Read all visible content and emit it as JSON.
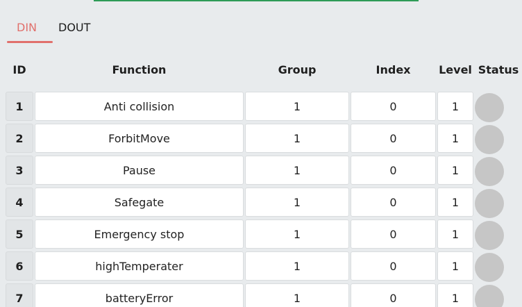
{
  "tabs": {
    "din_label": "DIN",
    "dout_label": "DOUT",
    "active": "DIN"
  },
  "table": {
    "headers": {
      "id": "ID",
      "function": "Function",
      "group": "Group",
      "index": "Index",
      "level": "Level",
      "status": "Status"
    },
    "rows": [
      {
        "id": "1",
        "function": "Anti collision",
        "group": "1",
        "index": "0",
        "level": "1",
        "status": "off"
      },
      {
        "id": "2",
        "function": "ForbitMove",
        "group": "1",
        "index": "0",
        "level": "1",
        "status": "off"
      },
      {
        "id": "3",
        "function": "Pause",
        "group": "1",
        "index": "0",
        "level": "1",
        "status": "off"
      },
      {
        "id": "4",
        "function": "Safegate",
        "group": "1",
        "index": "0",
        "level": "1",
        "status": "off"
      },
      {
        "id": "5",
        "function": "Emergency stop",
        "group": "1",
        "index": "0",
        "level": "1",
        "status": "off"
      },
      {
        "id": "6",
        "function": "highTemperater",
        "group": "1",
        "index": "0",
        "level": "1",
        "status": "off"
      },
      {
        "id": "7",
        "function": "batteryError",
        "group": "1",
        "index": "0",
        "level": "1",
        "status": "off"
      }
    ]
  },
  "colors": {
    "active_tab": "#e1706c",
    "accent_strip": "#2e9b57",
    "status_off": "#c6c6c6"
  }
}
